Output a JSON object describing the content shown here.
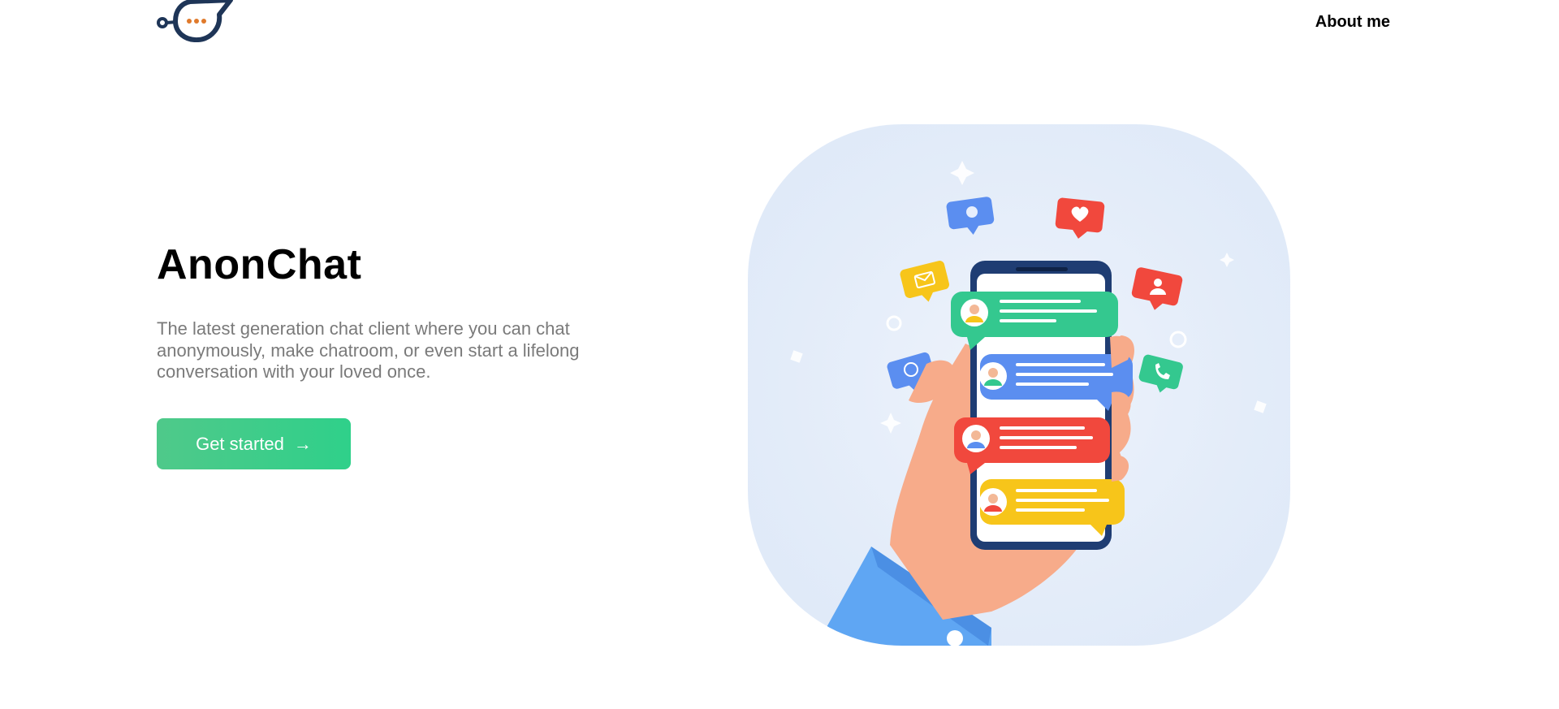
{
  "nav": {
    "logo_alt": "AnonChat logo",
    "about_label": "About me"
  },
  "hero": {
    "title": "AnonChat",
    "description": "The latest generation chat client where you can chat anonymously, make chatroom, or even start a lifelong conversation with your loved once.",
    "cta_label": "Get started",
    "cta_icon": "arrow-right-icon"
  },
  "illustration": {
    "alt": "Hand holding a phone with chat bubbles",
    "colors": {
      "green": "#34c88f",
      "blue": "#5b8ef0",
      "red": "#f1483d",
      "yellow": "#f7c51a",
      "skin": "#f7ab8a",
      "sleeve": "#5fa6f3",
      "phone": "#1f3d73"
    }
  }
}
